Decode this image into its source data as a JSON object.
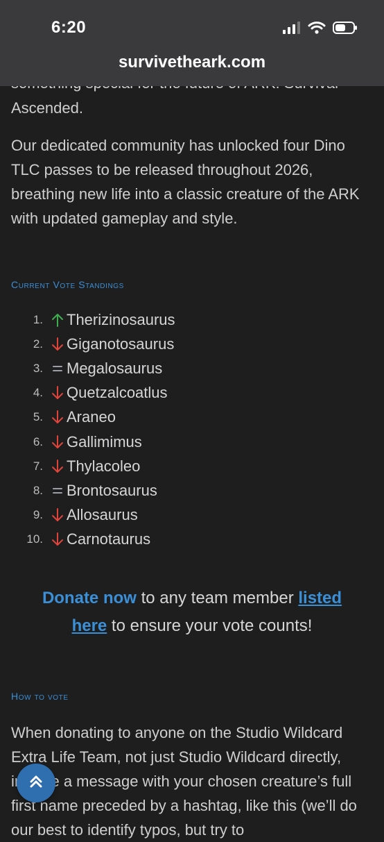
{
  "status_bar": {
    "time": "6:20",
    "icons": [
      "signal-icon",
      "wifi-icon",
      "battery-icon"
    ]
  },
  "browser": {
    "url": "survivetheark.com"
  },
  "article": {
    "cut_line": "something special for the future of ARK: Survival",
    "intro_paragraph_end": "Ascended.",
    "paragraph_2": "Our dedicated community has unlocked four Dino TLC passes to be released throughout 2026, breathing new life into a classic creature of the ARK with updated gameplay and style.",
    "standings_heading": "Current Vote Standings",
    "standings": [
      {
        "rank": "1.",
        "trend": "up",
        "name": "Therizinosaurus"
      },
      {
        "rank": "2.",
        "trend": "down",
        "name": "Giganotosaurus"
      },
      {
        "rank": "3.",
        "trend": "same",
        "name": "Megalosaurus"
      },
      {
        "rank": "4.",
        "trend": "down",
        "name": "Quetzalcoatlus"
      },
      {
        "rank": "5.",
        "trend": "down",
        "name": "Araneo"
      },
      {
        "rank": "6.",
        "trend": "down",
        "name": "Gallimimus"
      },
      {
        "rank": "7.",
        "trend": "down",
        "name": "Thylacoleo"
      },
      {
        "rank": "8.",
        "trend": "same",
        "name": "Brontosaurus"
      },
      {
        "rank": "9.",
        "trend": "down",
        "name": "Allosaurus"
      },
      {
        "rank": "10.",
        "trend": "down",
        "name": "Carnotaurus"
      }
    ],
    "donate": {
      "link1": "Donate now",
      "text1": " to any team member ",
      "link2a": "listed",
      "link2b": "here",
      "text2": " to ensure your vote counts!"
    },
    "how_to_heading": "How to vote",
    "paragraph_3": "When donating to anyone on the Studio Wildcard Extra Life Team, not just Studio Wildcard directly, include a message with your chosen creature’s full first name preceded by a hashtag, like this (we’ll do our best to identify typos, but try to"
  },
  "colors": {
    "accent": "#3b8fd6",
    "up": "#3fae4f",
    "down": "#e0443a",
    "same": "#9aa0a6"
  }
}
